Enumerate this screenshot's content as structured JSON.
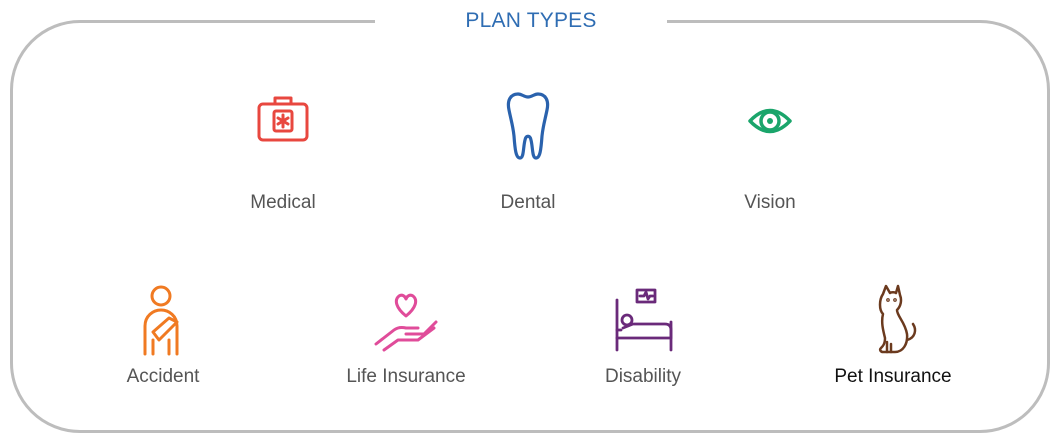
{
  "title": "PLAN TYPES",
  "plans": [
    {
      "label": "Medical",
      "icon": "first-aid-kit-icon",
      "color": "#e8473f"
    },
    {
      "label": "Dental",
      "icon": "tooth-icon",
      "color": "#2a62ad"
    },
    {
      "label": "Vision",
      "icon": "eye-icon",
      "color": "#1aa56b"
    },
    {
      "label": "Accident",
      "icon": "arm-sling-icon",
      "color": "#f07a22"
    },
    {
      "label": "Life Insurance",
      "icon": "heart-in-hand-icon",
      "color": "#e04c9a"
    },
    {
      "label": "Disability",
      "icon": "hospital-bed-monitor-icon",
      "color": "#6a2a7a"
    },
    {
      "label": "Pet Insurance",
      "icon": "cat-icon",
      "color": "#6b3a1e"
    }
  ],
  "colors": {
    "frame": "#bdbdbd",
    "title": "#2f6db3",
    "label": "#555555"
  }
}
